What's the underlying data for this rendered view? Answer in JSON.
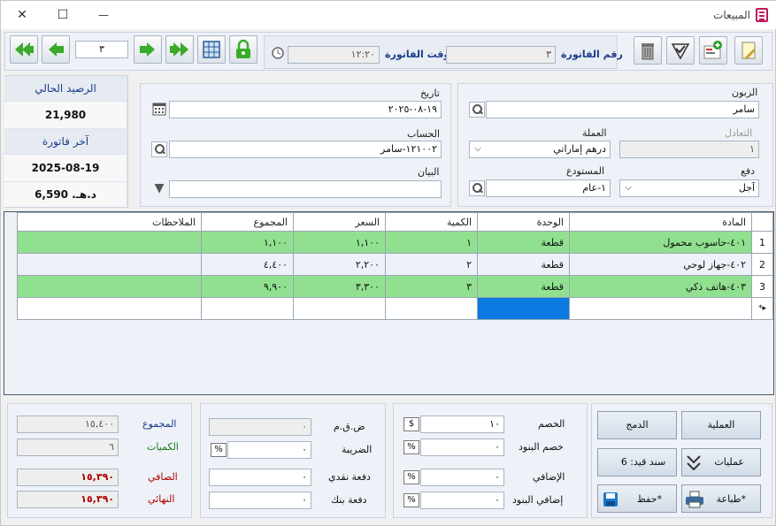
{
  "window": {
    "title": "المبيعات",
    "minimize": "—",
    "maximize": "☐",
    "close": "✕"
  },
  "toolbar": {
    "record_no": "٣",
    "invoice_time_label": "وقت الفاتورة",
    "invoice_time": "١٢:٢٠",
    "invoice_no_label": "رقم الفاتورة",
    "invoice_no": "٣"
  },
  "header": {
    "customer_label": "الزبون",
    "customer": "سامر",
    "date_label": "تاريخ",
    "date": "١٩-٠٨-٢٠٢٥",
    "currency_label": "العملة",
    "currency": "درهم إماراتي",
    "exchange_label": "التعادل",
    "exchange": "١",
    "account_label": "الحساب",
    "account": "١٢١٠٠٢-سامر",
    "payment_label": "دفع",
    "payment": "آجل",
    "warehouse_label": "المستودع",
    "warehouse": "١-عام",
    "statement_label": "البيان",
    "statement": ""
  },
  "side": {
    "balance_label": "الرصيد الحالي",
    "balance": "21,980",
    "last_invoice_label": "آخر فاتورة",
    "last_invoice_date": "2025-08-19",
    "last_invoice_amount": "6,590 .د.هـ"
  },
  "grid": {
    "columns": [
      "المادة",
      "الوحدة",
      "الكمية",
      "السعر",
      "المجموع",
      "الملاحظات"
    ],
    "rows": [
      {
        "n": "1",
        "item": "٤٠١-حاسوب محمول",
        "unit": "قطعة",
        "qty": "١",
        "price": "١,١٠٠",
        "total": "١,١٠٠",
        "notes": ""
      },
      {
        "n": "2",
        "item": "٤٠٢-جهاز لوحي",
        "unit": "قطعة",
        "qty": "٢",
        "price": "٢,٢٠٠",
        "total": "٤,٤٠٠",
        "notes": ""
      },
      {
        "n": "3",
        "item": "٤٠٣-هاتف ذكي",
        "unit": "قطعة",
        "qty": "٣",
        "price": "٣,٣٠٠",
        "total": "٩,٩٠٠",
        "notes": ""
      }
    ],
    "new_row_marker": "▸*"
  },
  "totals": {
    "sum_label": "المجموع",
    "sum": "١٥,٤٠٠",
    "qty_label": "الكميات",
    "qty": "٦",
    "net_label": "الصافي",
    "net": "١٥,٣٩٠",
    "final_label": "النهائي",
    "final": "١٥,٣٩٠"
  },
  "tax": {
    "vat_label": "ض.ق.م",
    "vat": "٠",
    "tax_label": "الضريبة",
    "tax": "٠",
    "tax_unit": "%",
    "cash_label": "دفعة نقدي",
    "cash": "٠",
    "bank_label": "دفعة بنك",
    "bank": "٠"
  },
  "discounts": {
    "discount_label": "الخصم",
    "discount": "١٠",
    "discount_unit": "$",
    "item_discount_label": "خصم البنود",
    "item_discount": "٠",
    "item_discount_unit": "%",
    "extra_label": "الإضافي",
    "extra": "٠",
    "extra_unit": "%",
    "item_extra_label": "إضافي البنود",
    "item_extra": "٠",
    "item_extra_unit": "%"
  },
  "actions": {
    "operation": "العملية",
    "merge": "الدمج",
    "operations": "عمليات",
    "entry": "سند قيد: 6",
    "print": "طباعة*",
    "save": "حفظ*"
  },
  "colors": {
    "green_row": "#90e090",
    "red_value": "#b00000",
    "blue_label": "#1a3a8a",
    "green_label": "#1a7a1a",
    "selection": "#0a7ae0"
  }
}
